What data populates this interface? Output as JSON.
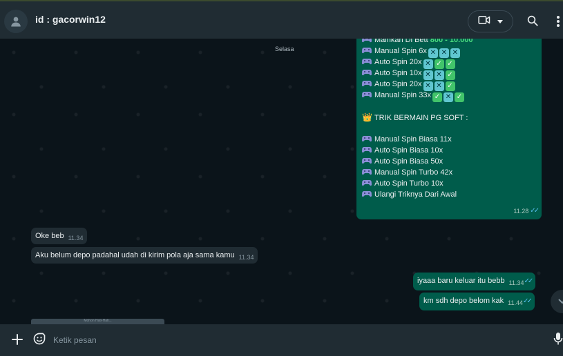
{
  "header": {
    "title": "id : gacorwin12",
    "icons": {
      "avatar": "user-avatar-icon",
      "video": "video-call-icon",
      "dropdown": "chevron-down-icon",
      "search": "search-icon",
      "menu": "more-vertical-icon"
    }
  },
  "chat": {
    "day_label": "Selasa",
    "big_message": {
      "lines": [
        {
          "prefix": "pad",
          "text": "Mainkan Di Bett ",
          "highlight": "800 - 10.000",
          "marks": []
        },
        {
          "prefix": "pad",
          "text": "Manual Spin 6x",
          "highlight": "",
          "marks": [
            "x",
            "x",
            "x"
          ]
        },
        {
          "prefix": "pad",
          "text": "Auto Spin 20x",
          "highlight": "",
          "marks": [
            "x",
            "v",
            "v"
          ]
        },
        {
          "prefix": "pad",
          "text": "Auto Spin 10x",
          "highlight": "",
          "marks": [
            "x",
            "x",
            "v"
          ]
        },
        {
          "prefix": "pad",
          "text": "Auto Spin 20x",
          "highlight": "",
          "marks": [
            "x",
            "x",
            "v"
          ]
        },
        {
          "prefix": "pad",
          "text": "Manual Spin 33x",
          "highlight": "",
          "marks": [
            "v",
            "x",
            "v"
          ]
        },
        {
          "gap": true
        },
        {
          "prefix": "crown",
          "text": "TRIK BERMAIN PG SOFT :",
          "highlight": "",
          "marks": []
        },
        {
          "gap": true
        },
        {
          "prefix": "pad",
          "text": "Manual Spin Biasa 11x",
          "highlight": "",
          "marks": []
        },
        {
          "prefix": "pad",
          "text": "Auto Spin Biasa 10x",
          "highlight": "",
          "marks": []
        },
        {
          "prefix": "pad",
          "text": "Auto Spin Biasa 50x",
          "highlight": "",
          "marks": []
        },
        {
          "prefix": "pad",
          "text": "Manual Spin Turbo 42x",
          "highlight": "",
          "marks": []
        },
        {
          "prefix": "pad",
          "text": "Auto Spin Turbo 10x",
          "highlight": "",
          "marks": []
        },
        {
          "prefix": "pad",
          "text": "Ulangi Triknya Dari Awal",
          "highlight": "",
          "marks": []
        }
      ],
      "time": "11.28"
    },
    "incoming": [
      {
        "text": "Oke beb",
        "time": "11.34"
      },
      {
        "text": "Aku belum depo padahal udah di kirim pola aja sama kamu",
        "time": "11.34"
      }
    ],
    "outgoing": [
      {
        "text": "iyaaa baru keluar itu bebb",
        "time": "11.34"
      },
      {
        "text": "km sdh depo belom kak",
        "time": "11.44"
      }
    ],
    "read_ticks": "✓✓",
    "preview_caption": "Mohon Hati-Hati..."
  },
  "composer": {
    "placeholder": "Ketik pesan",
    "icons": {
      "attach": "plus-icon",
      "emoji": "sticker-icon",
      "mic": "microphone-icon"
    }
  },
  "colors": {
    "outgoing_bubble": "#005c4b",
    "incoming_bubble": "#202c33",
    "header": "#202c33",
    "background": "#0b141a",
    "highlight": "#4ade80"
  }
}
